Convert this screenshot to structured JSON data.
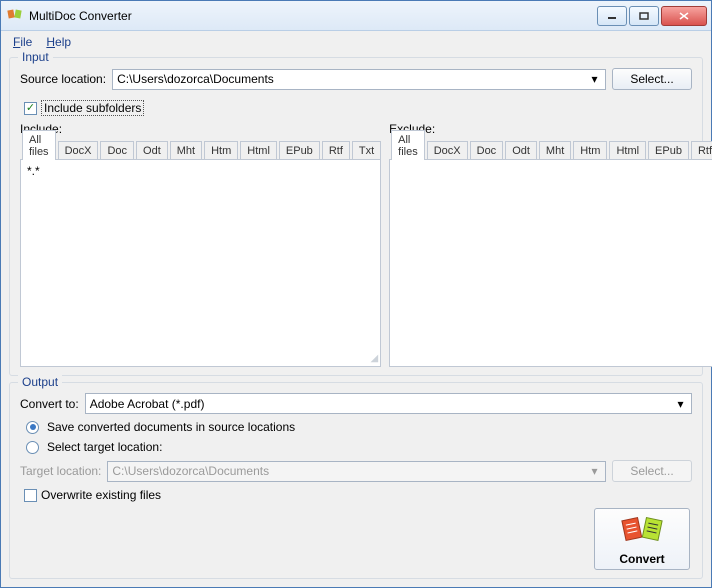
{
  "window": {
    "title": "MultiDoc Converter"
  },
  "menu": {
    "file": "File",
    "help": "Help"
  },
  "input": {
    "legend": "Input",
    "source_label": "Source location:",
    "source_value": "C:\\Users\\dozorca\\Documents",
    "select_btn": "Select...",
    "include_subfolders": "Include subfolders",
    "include_subfolders_checked": true,
    "include_label": "Include:",
    "exclude_label": "Exclude:",
    "tabs": [
      "All files",
      "DocX",
      "Doc",
      "Odt",
      "Mht",
      "Htm",
      "Html",
      "EPub",
      "Rtf",
      "Txt"
    ],
    "include_pattern": "*.*",
    "exclude_pattern": ""
  },
  "output": {
    "legend": "Output",
    "convert_to_label": "Convert to:",
    "convert_to_value": "Adobe Acrobat (*.pdf)",
    "save_in_source": "Save converted documents in source locations",
    "select_target": "Select target location:",
    "radio_selected": "source",
    "target_label": "Target location:",
    "target_value": "C:\\Users\\dozorca\\Documents",
    "target_select_btn": "Select...",
    "overwrite": "Overwrite existing files",
    "overwrite_checked": false,
    "convert_btn": "Convert"
  }
}
